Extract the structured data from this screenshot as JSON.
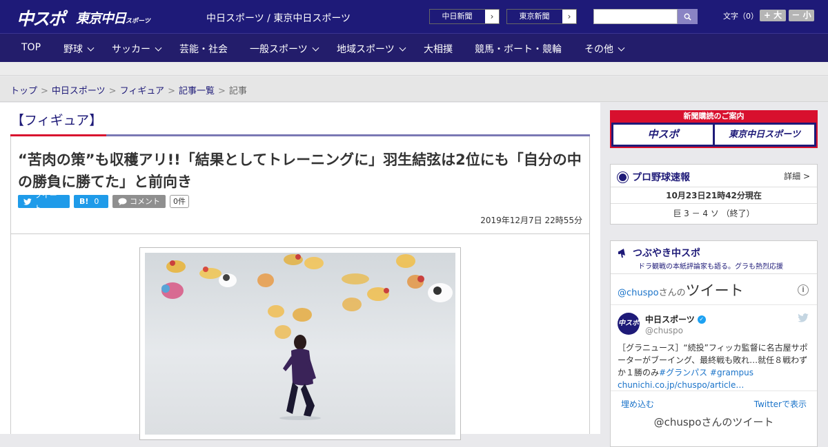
{
  "header": {
    "logo_chuspo": "中スポ",
    "logo_tokyo": "東京中日",
    "logo_tokyo_small": "スポーツ",
    "site_title": "中日スポーツ / 東京中日スポーツ",
    "paper_links": [
      {
        "label": "中日新聞",
        "arrow": "›"
      },
      {
        "label": "東京新聞",
        "arrow": "›"
      }
    ],
    "search": {
      "placeholder": "",
      "icon": "search-icon"
    },
    "font_size_label": "文字（0）",
    "font_bigger": "+ 大",
    "font_smaller": "－ 小"
  },
  "nav": {
    "items": [
      {
        "label": "TOP",
        "dropdown": false
      },
      {
        "label": "野球",
        "dropdown": true
      },
      {
        "label": "サッカー",
        "dropdown": true
      },
      {
        "label": "芸能・社会",
        "dropdown": false
      },
      {
        "label": "一般スポーツ",
        "dropdown": true
      },
      {
        "label": "地域スポーツ",
        "dropdown": true
      },
      {
        "label": "大相撲",
        "dropdown": false
      },
      {
        "label": "競馬・ボート・競輪",
        "dropdown": false
      },
      {
        "label": "その他",
        "dropdown": true
      }
    ]
  },
  "breadcrumb": {
    "items": [
      "トップ",
      "中日スポーツ",
      "フィギュア",
      "記事一覧"
    ],
    "sep": ">",
    "current": "記事"
  },
  "article": {
    "category": "【フィギュア】",
    "headline": "“苦肉の策”も収穫アリ!!「結果としてトレーニングに」羽生結弦は2位にも「自分の中の勝負に勝てた」と前向き",
    "share": {
      "tweet": "ツイート",
      "hatena": "B!",
      "hatena_count": "0",
      "comment": "コメント",
      "comment_count": "0件"
    },
    "pubdate": "2019年12月7日 22時55分"
  },
  "sidebar": {
    "subscription": {
      "title": "新聞購読のご案内",
      "logo1": "中スポ",
      "logo2": "東京中日スポーツ"
    },
    "baseball": {
      "title": "プロ野球速報",
      "detail": "詳細 >",
      "time": "10月23日21時42分現在",
      "score": "巨 3 － 4 ソ （終了）"
    },
    "tsubuyaki": {
      "title": "つぶやき中スポ",
      "tagline": "ドラ観戦の本紙評論家も語る。グラも熱烈応援"
    },
    "twitter": {
      "handle": "@chuspo",
      "san": "さんの",
      "tweets_label": "ツイート",
      "account_name": "中日スポーツ",
      "account_handle": "@chuspo",
      "avatar_text": "中スポ",
      "tweet_text": "［グラニュース］“続投”フィッカ監督に名古屋サポーターがブーイング、最終戦も敗れ…就任８戦わずか１勝のみ",
      "hashtag1": "#グランパス",
      "hashtag2": "#grampus",
      "link": "chunichi.co.jp/chuspo/article…",
      "embed": "埋め込む",
      "view_on_twitter": "Twitterで表示",
      "footer_text": "@chuspoさんのツイート"
    }
  },
  "colors": {
    "brand_navy": "#1e1a78",
    "accent_red": "#d8102e",
    "twitter_blue": "#1f9be9"
  }
}
